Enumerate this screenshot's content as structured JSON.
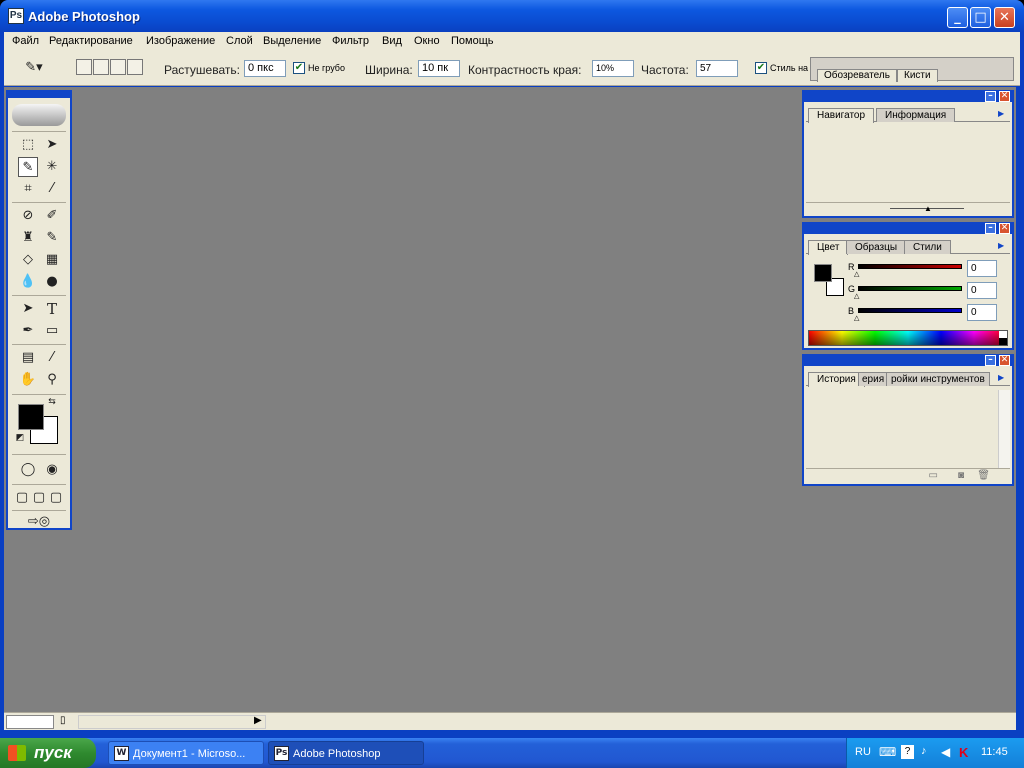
{
  "window": {
    "title": "Adobe Photoshop",
    "app_icon": "photoshop-icon",
    "controls": {
      "minimize": "_",
      "maximize": "□",
      "close": "✕"
    }
  },
  "menu": [
    "Файл",
    "Редактирование",
    "Изображение",
    "Слой",
    "Выделение",
    "Фильтр",
    "Вид",
    "Окно",
    "Помощь"
  ],
  "options": {
    "feather_label": "Растушевать:",
    "feather_value": "0 пкс",
    "antialias_label": "Не грубо",
    "antialias_checked": true,
    "width_label": "Ширина:",
    "width_value": "10 пк",
    "edge_contrast_label": "Контрастность края:",
    "edge_contrast_value": "10%",
    "frequency_label": "Частота:",
    "frequency_value": "57",
    "stylus_label": "Стиль на",
    "palette_well_tabs": [
      "Обозреватель",
      "Кисти"
    ]
  },
  "toolbox": {
    "tools": [
      "rectangular-marquee",
      "move",
      "magnetic-lasso",
      "magic-wand",
      "crop",
      "slice",
      "healing-brush",
      "brush",
      "clone-stamp",
      "history-brush",
      "eraser",
      "gradient",
      "blur",
      "dodge",
      "path-selection",
      "type",
      "pen",
      "rectangle",
      "notes",
      "eyedropper",
      "hand",
      "zoom"
    ],
    "foreground": "#000000",
    "background": "#ffffff"
  },
  "navigator_panel": {
    "tabs": [
      "Навигатор",
      "Информация"
    ],
    "active": "Навигатор"
  },
  "color_panel": {
    "tabs": [
      "Цвет",
      "Образцы",
      "Стили"
    ],
    "active": "Цвет",
    "channels": [
      {
        "label": "R",
        "value": "0",
        "color": "#cc0000"
      },
      {
        "label": "G",
        "value": "0",
        "color": "#00aa00"
      },
      {
        "label": "B",
        "value": "0",
        "color": "#0000cc"
      }
    ]
  },
  "history_panel": {
    "tabs": [
      "История",
      "ерия",
      "ройки инструментов"
    ],
    "active": "История"
  },
  "taskbar": {
    "start_label": "пуск",
    "buttons": [
      {
        "label": "Документ1 - Microso...",
        "icon": "word-icon",
        "active": false
      },
      {
        "label": "Adobe Photoshop",
        "icon": "photoshop-icon",
        "active": true
      }
    ],
    "tray": {
      "lang": "RU",
      "clock": "11:45"
    }
  },
  "colors": {
    "titlebar": "#0a4bd0",
    "workspace": "#808080",
    "panel_bg": "#ece9d8",
    "taskbar": "#2157d1",
    "start": "#2f8a2f"
  }
}
